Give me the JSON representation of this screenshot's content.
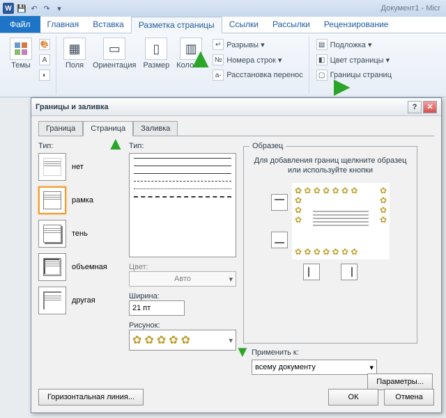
{
  "titlebar": {
    "doc": "Документ1 - Micr"
  },
  "ribbon_tabs": {
    "file": "Файл",
    "home": "Главная",
    "insert": "Вставка",
    "layout": "Разметка страницы",
    "refs": "Ссылки",
    "mail": "Рассылки",
    "review": "Рецензирование"
  },
  "ribbon": {
    "themes": "Темы",
    "margins": "Поля",
    "orientation": "Ориентация",
    "size": "Размер",
    "columns": "Колонки",
    "breaks": "Разрывы ▾",
    "line_numbers": "Номера строк ▾",
    "hyphenation": "Расстановка перенос",
    "watermark": "Подложка ▾",
    "page_color": "Цвет страницы ▾",
    "page_borders": "Границы страниц"
  },
  "dialog": {
    "title": "Границы и заливка",
    "tabs": {
      "border": "Граница",
      "page": "Страница",
      "fill": "Заливка"
    },
    "type_label": "Тип:",
    "types": {
      "none": "нет",
      "box": "рамка",
      "shadow": "тень",
      "threeD": "объемная",
      "custom": "другая"
    },
    "style_label": "Тип:",
    "color_label": "Цвет:",
    "color_value": "Авто",
    "width_label": "Ширина:",
    "width_value": "21 пт",
    "art_label": "Рисунок:",
    "preview_legend": "Образец",
    "preview_hint": "Для добавления границ щелкните образец или используйте кнопки",
    "apply_label": "Применить к:",
    "apply_value": "всему документу",
    "params_btn": "Параметры...",
    "hline_btn": "Горизонтальная линия...",
    "ok": "ОК",
    "cancel": "Отмена"
  }
}
